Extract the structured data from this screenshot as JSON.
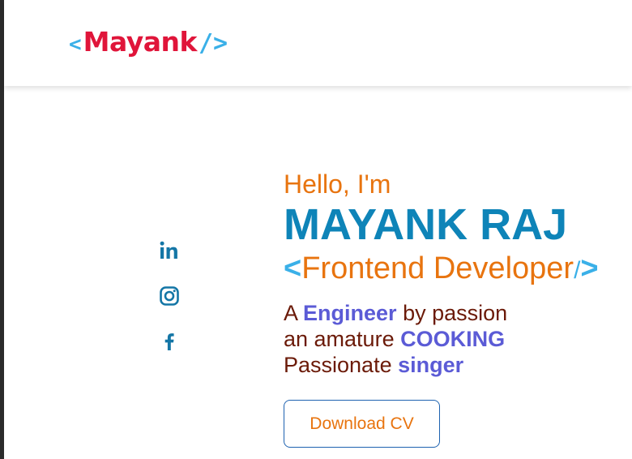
{
  "header": {
    "logo": {
      "open": "<",
      "name": "Mayank",
      "close": "/>"
    }
  },
  "socials": [
    {
      "icon": "linkedin-icon"
    },
    {
      "icon": "instagram-icon"
    },
    {
      "icon": "facebook-icon"
    }
  ],
  "hero": {
    "greeting": "Hello, I'm",
    "name": "MAYANK RAJ",
    "role": {
      "open": "<",
      "title": "Frontend Developer",
      "slash": "/",
      "close": ">"
    },
    "lines": [
      {
        "pre": "A ",
        "highlight": "Engineer",
        "post": " by passion"
      },
      {
        "pre": "an amature ",
        "highlight": "COOKING",
        "post": ""
      },
      {
        "pre": "Passionate ",
        "highlight": "singer",
        "post": ""
      }
    ],
    "cta_label": "Download CV"
  },
  "colors": {
    "accent_orange": "#e8740f",
    "name_blue": "#0e84b8",
    "logo_red": "#e0153a",
    "bracket_blue": "#3ab0e8",
    "highlight_purple": "#5b5bd6",
    "text_maroon": "#6b1a08",
    "icon_blue": "#1476a6"
  }
}
